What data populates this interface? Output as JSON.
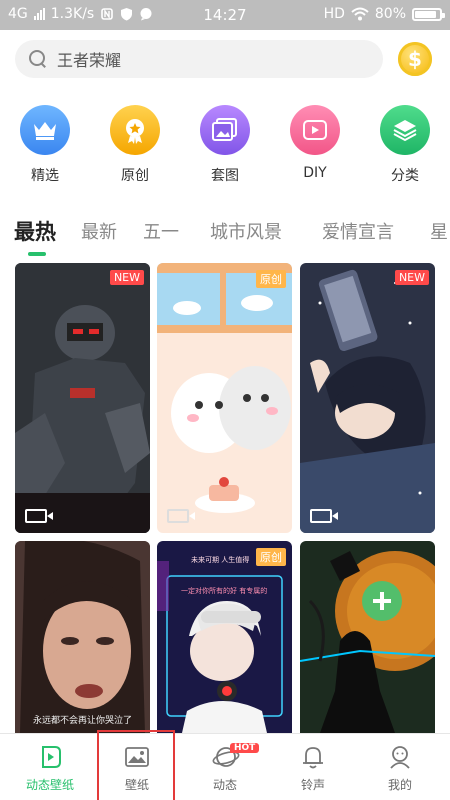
{
  "status_bar": {
    "network": "4G",
    "speed": "1.3K/s",
    "time": "14:27",
    "hd": "HD",
    "battery": "80%"
  },
  "search": {
    "placeholder": "王者荣耀",
    "coin_icon": "dollar-coin-icon"
  },
  "categories": [
    {
      "label": "精选",
      "icon": "crown-icon",
      "color": "#3a86f0"
    },
    {
      "label": "原创",
      "icon": "star-badge-icon",
      "color": "#f5a600"
    },
    {
      "label": "套图",
      "icon": "image-stack-icon",
      "color": "#8155e8"
    },
    {
      "label": "DIY",
      "icon": "video-play-icon",
      "color": "#f25688"
    },
    {
      "label": "分类",
      "icon": "layers-icon",
      "color": "#1fb566"
    }
  ],
  "tabs": [
    {
      "label": "最热",
      "active": true
    },
    {
      "label": "最新"
    },
    {
      "label": "五一"
    },
    {
      "label": "城市风景"
    },
    {
      "label": "爱情宣言"
    },
    {
      "label": "星"
    }
  ],
  "wallpapers": [
    {
      "badge": "NEW",
      "badge_type": "new",
      "video": true,
      "subject": "robot"
    },
    {
      "badge": "原创",
      "badge_type": "original",
      "video": true,
      "subject": "cute-cats"
    },
    {
      "badge": "NEW",
      "badge_type": "new",
      "video": true,
      "subject": "anime-boy-phone"
    },
    {
      "badge": "",
      "video": false,
      "subject": "crying-woman",
      "caption": "永远都不会再让你哭泣了"
    },
    {
      "badge": "原创",
      "badge_type": "original",
      "video": false,
      "subject": "anime-boy-headphones",
      "caption_top": "未来可期 人生值得",
      "caption_mid": "一定对你所有的好 有专属的"
    },
    {
      "badge": "",
      "video": false,
      "subject": "silhouette-moon"
    }
  ],
  "bottom_nav": [
    {
      "label": "动态壁纸",
      "icon": "play-live-icon",
      "active": true
    },
    {
      "label": "壁纸",
      "icon": "picture-icon"
    },
    {
      "label": "动态",
      "icon": "planet-icon",
      "badge": "HOT"
    },
    {
      "label": "铃声",
      "icon": "bell-icon"
    },
    {
      "label": "我的",
      "icon": "user-icon"
    }
  ],
  "colors": {
    "accent": "#27c06c",
    "badge_new": "#ff4a4a",
    "badge_original": "#ffb64a",
    "highlight": "#e33a3a"
  }
}
